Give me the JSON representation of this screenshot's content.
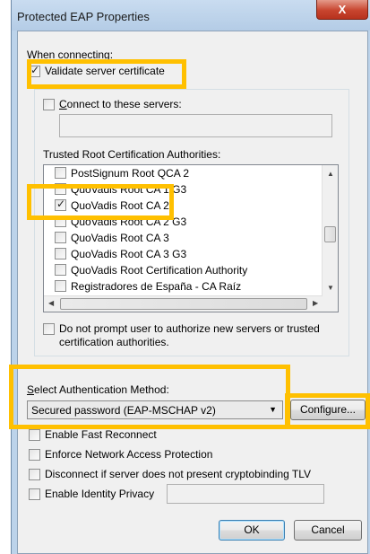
{
  "window": {
    "title": "Protected EAP Properties",
    "close_glyph": "X"
  },
  "connecting": {
    "heading": "When connecting:",
    "validate_label": "Validate server certificate",
    "validate_checked": true,
    "connect_label": "Connect to these servers:",
    "connect_checked": false,
    "servers_value": ""
  },
  "trusted": {
    "heading": "Trusted Root Certification Authorities:",
    "items": [
      {
        "label": "PostSignum Root QCA 2",
        "checked": false
      },
      {
        "label": "QuoVadis Root CA 1 G3",
        "checked": false
      },
      {
        "label": "QuoVadis Root CA 2",
        "checked": true
      },
      {
        "label": "QuoVadis Root CA 2 G3",
        "checked": false
      },
      {
        "label": "QuoVadis Root CA 3",
        "checked": false
      },
      {
        "label": "QuoVadis Root CA 3 G3",
        "checked": false
      },
      {
        "label": "QuoVadis Root Certification Authority",
        "checked": false
      },
      {
        "label": "Registradores de España - CA Raíz",
        "checked": false
      }
    ]
  },
  "prompt": {
    "label_line1": "Do not prompt user to authorize new servers or trusted",
    "label_line2": "certification authorities.",
    "checked": false
  },
  "auth": {
    "heading": "Select Authentication Method:",
    "selected": "Secured password (EAP-MSCHAP v2)",
    "configure_label": "Configure..."
  },
  "options": [
    {
      "label": "Enable Fast Reconnect",
      "checked": false
    },
    {
      "label": "Enforce Network Access Protection",
      "checked": false
    },
    {
      "label": "Disconnect if server does not present cryptobinding TLV",
      "checked": false
    },
    {
      "label": "Enable Identity Privacy",
      "checked": false
    }
  ],
  "identity_value": "",
  "footer": {
    "ok_label": "OK",
    "cancel_label": "Cancel"
  },
  "highlight_color": "#ffc000"
}
